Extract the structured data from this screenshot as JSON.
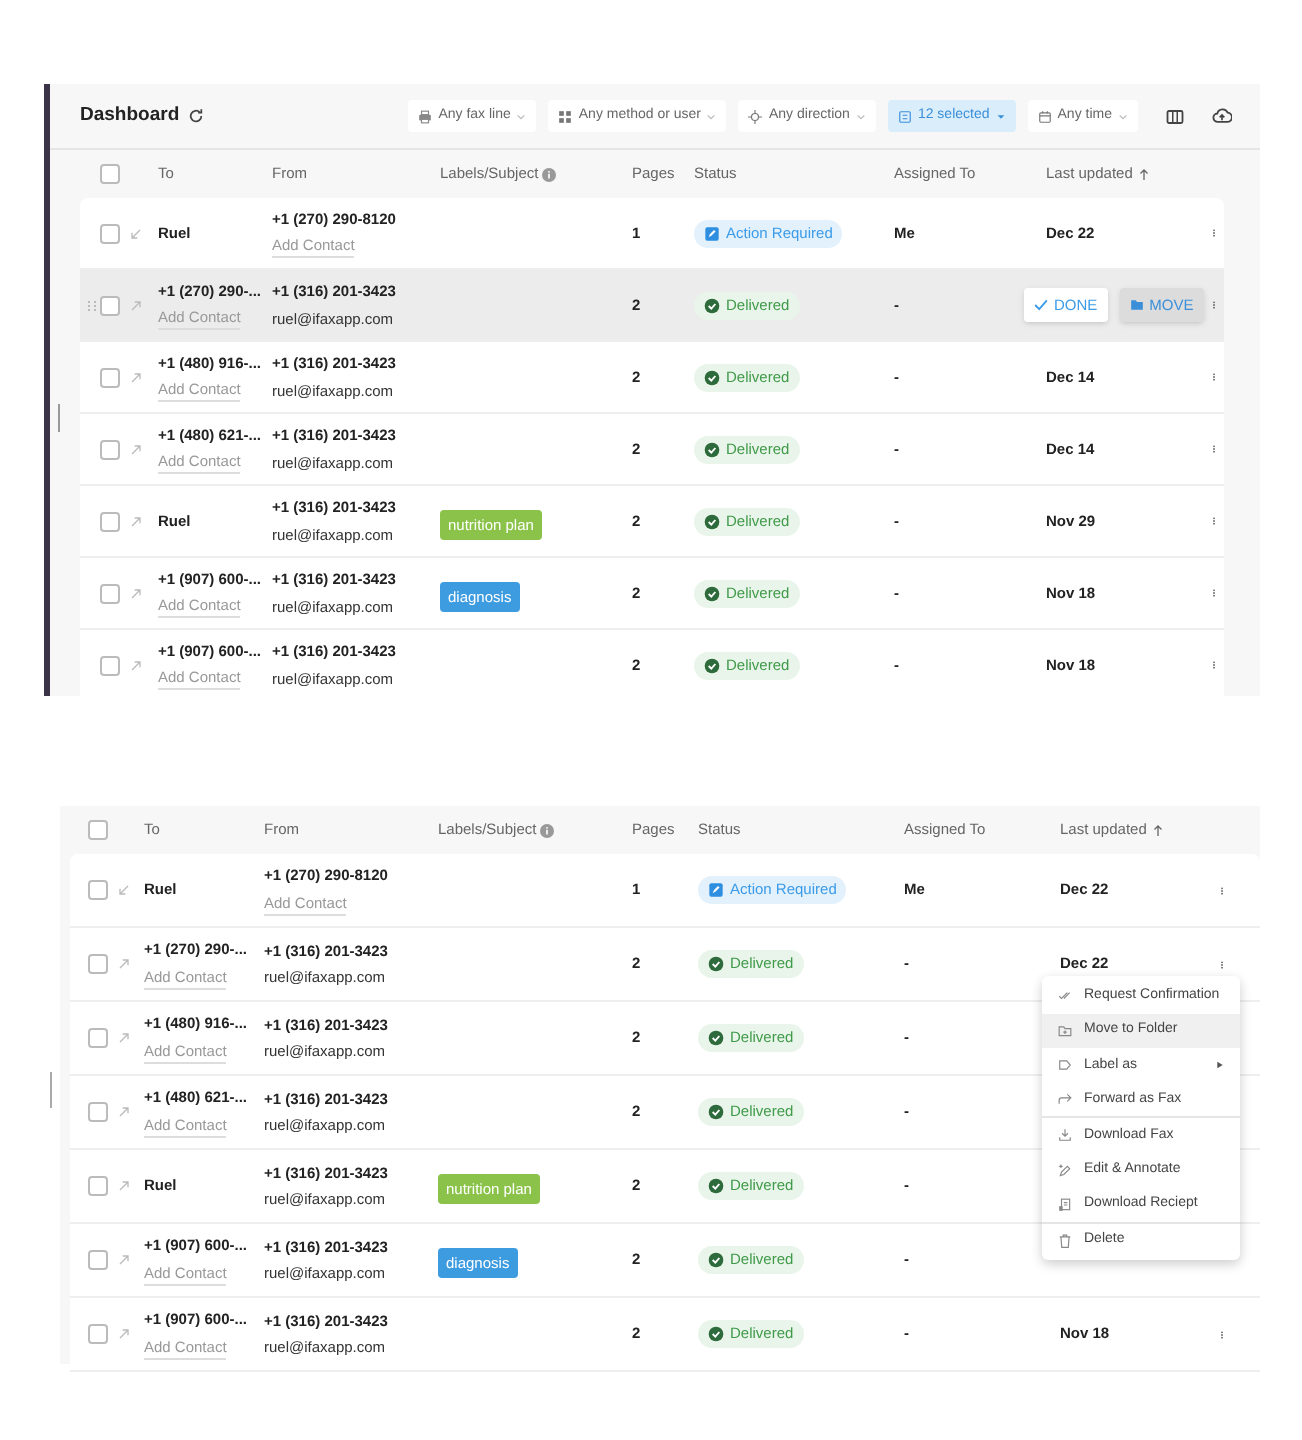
{
  "dashboard": {
    "title": "Dashboard",
    "filters": [
      {
        "label": "Any fax line",
        "selected": false
      },
      {
        "label": "Any method or user",
        "selected": false
      },
      {
        "label": "Any direction",
        "selected": false
      },
      {
        "label": "12 selected",
        "selected": true
      },
      {
        "label": "Any time",
        "selected": false
      }
    ],
    "select_all_checked": false,
    "columns": [
      "To",
      "From",
      "Labels/Subject",
      "Pages",
      "Status",
      "Assigned To",
      "Last updated"
    ],
    "rows": [
      {
        "checked": false,
        "incoming": true,
        "to": "Ruel",
        "from": "+1 (270) 290-8120",
        "from_link": "Add Contact",
        "pages": "1",
        "status": {
          "kind": "action",
          "text": "Action Required"
        },
        "assigned": "Me",
        "updated": "Dec 22",
        "hovered": false
      },
      {
        "checked": false,
        "incoming": false,
        "to": "+1 (270) 290-...",
        "to_sub": "Add Contact",
        "from": "+1 (316) 201-3423",
        "from_email": "ruel@ifaxapp.com",
        "pages": "2",
        "status": {
          "kind": "delivered",
          "text": "Delivered"
        },
        "assigned": "-",
        "hovered": true,
        "actions": [
          {
            "kind": "done",
            "label": "DONE"
          },
          {
            "kind": "move",
            "label": "MOVE"
          }
        ]
      },
      {
        "checked": false,
        "incoming": false,
        "to": "+1 (480) 916-...",
        "to_sub": "Add Contact",
        "from": "+1 (316) 201-3423",
        "from_email": "ruel@ifaxapp.com",
        "pages": "2",
        "status": {
          "kind": "delivered",
          "text": "Delivered"
        },
        "assigned": "-",
        "updated": "Dec 14",
        "hovered": false
      },
      {
        "checked": false,
        "incoming": false,
        "to": "+1 (480) 621-...",
        "to_sub": "Add Contact",
        "from": "+1 (316) 201-3423",
        "from_email": "ruel@ifaxapp.com",
        "pages": "2",
        "status": {
          "kind": "delivered",
          "text": "Delivered"
        },
        "assigned": "-",
        "updated": "Dec 14",
        "hovered": false
      },
      {
        "checked": false,
        "incoming": false,
        "to": "Ruel",
        "from": "+1 (316) 201-3423",
        "from_email": "ruel@ifaxapp.com",
        "label": {
          "text": "nutrition plan",
          "color": "#8bc34a"
        },
        "pages": "2",
        "status": {
          "kind": "delivered",
          "text": "Delivered"
        },
        "assigned": "-",
        "updated": "Nov 29",
        "hovered": false
      },
      {
        "checked": false,
        "incoming": false,
        "to": "+1 (907) 600-...",
        "to_sub": "Add Contact",
        "from": "+1 (316) 201-3423",
        "from_email": "ruel@ifaxapp.com",
        "label": {
          "text": "diagnosis",
          "color": "#3d9be0"
        },
        "pages": "2",
        "status": {
          "kind": "delivered",
          "text": "Delivered"
        },
        "assigned": "-",
        "updated": "Nov 18",
        "hovered": false
      },
      {
        "checked": false,
        "incoming": false,
        "to": "+1 (907) 600-...",
        "to_sub": "Add Contact",
        "from": "+1 (316) 201-3423",
        "from_email": "ruel@ifaxapp.com",
        "pages": "2",
        "status": {
          "kind": "delivered",
          "text": "Delivered"
        },
        "assigned": "-",
        "updated": "Nov 18",
        "hovered": false
      }
    ]
  },
  "table_with_menu": {
    "select_all_checked": false,
    "columns": [
      "To",
      "From",
      "Labels/Subject",
      "Pages",
      "Status",
      "Assigned To",
      "Last updated"
    ],
    "rows": [
      {
        "checked": false,
        "incoming": true,
        "to": "Ruel",
        "from": "+1 (270) 290-8120",
        "from_link": "Add Contact",
        "pages": "1",
        "status": {
          "kind": "action",
          "text": "Action Required"
        },
        "assigned": "Me",
        "updated": "Dec 22"
      },
      {
        "checked": false,
        "incoming": false,
        "to": "+1 (270) 290-...",
        "to_sub": "Add Contact",
        "from": "+1 (316) 201-3423",
        "from_email": "ruel@ifaxapp.com",
        "pages": "2",
        "status": {
          "kind": "delivered",
          "text": "Delivered"
        },
        "assigned": "-",
        "updated": "Dec 22"
      },
      {
        "checked": false,
        "incoming": false,
        "to": "+1 (480) 916-...",
        "to_sub": "Add Contact",
        "from": "+1 (316) 201-3423",
        "from_email": "ruel@ifaxapp.com",
        "pages": "2",
        "status": {
          "kind": "delivered",
          "text": "Delivered"
        },
        "assigned": "-"
      },
      {
        "checked": false,
        "incoming": false,
        "to": "+1 (480) 621-...",
        "to_sub": "Add Contact",
        "from": "+1 (316) 201-3423",
        "from_email": "ruel@ifaxapp.com",
        "pages": "2",
        "status": {
          "kind": "delivered",
          "text": "Delivered"
        },
        "assigned": "-"
      },
      {
        "checked": false,
        "incoming": false,
        "to": "Ruel",
        "from": "+1 (316) 201-3423",
        "from_email": "ruel@ifaxapp.com",
        "label": {
          "text": "nutrition plan",
          "color": "#8bc34a"
        },
        "pages": "2",
        "status": {
          "kind": "delivered",
          "text": "Delivered"
        },
        "assigned": "-"
      },
      {
        "checked": false,
        "incoming": false,
        "to": "+1 (907) 600-...",
        "to_sub": "Add Contact",
        "from": "+1 (316) 201-3423",
        "from_email": "ruel@ifaxapp.com",
        "label": {
          "text": "diagnosis",
          "color": "#3d9be0"
        },
        "pages": "2",
        "status": {
          "kind": "delivered",
          "text": "Delivered"
        },
        "assigned": "-"
      },
      {
        "checked": false,
        "incoming": false,
        "to": "+1 (907) 600-...",
        "to_sub": "Add Contact",
        "from": "+1 (316) 201-3423",
        "from_email": "ruel@ifaxapp.com",
        "pages": "2",
        "status": {
          "kind": "delivered",
          "text": "Delivered"
        },
        "assigned": "-",
        "updated": "Nov 18"
      }
    ],
    "menu": [
      {
        "label": "Request Confirmation",
        "highlighted": false,
        "submenu": false,
        "divider_after": false
      },
      {
        "label": "Move to Folder",
        "highlighted": true,
        "submenu": false,
        "divider_after": false
      },
      {
        "label": "Label as",
        "highlighted": false,
        "submenu": true,
        "divider_after": false
      },
      {
        "label": "Forward as Fax",
        "highlighted": false,
        "submenu": false,
        "divider_after": true
      },
      {
        "label": "Download Fax",
        "highlighted": false,
        "submenu": false,
        "divider_after": false
      },
      {
        "label": "Edit & Annotate",
        "highlighted": false,
        "submenu": false,
        "divider_after": false
      },
      {
        "label": "Download Reciept",
        "highlighted": false,
        "submenu": false,
        "divider_after": true
      },
      {
        "label": "Delete",
        "highlighted": false,
        "submenu": false,
        "divider_after": false
      }
    ]
  }
}
